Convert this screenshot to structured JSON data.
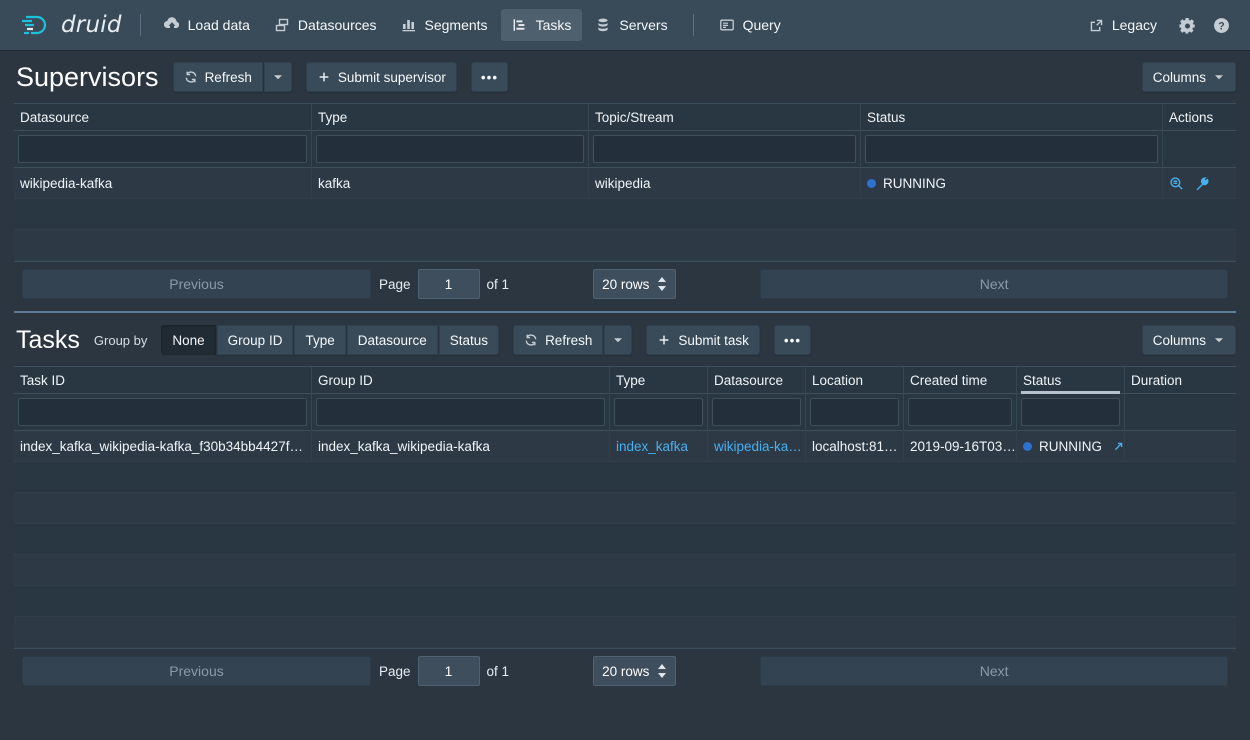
{
  "nav": {
    "brand": "druid",
    "items": [
      {
        "label": "Load data",
        "icon": "cloud-upload-icon",
        "active": false
      },
      {
        "label": "Datasources",
        "icon": "multi-layer-icon",
        "active": false
      },
      {
        "label": "Segments",
        "icon": "stacked-chart-icon",
        "active": false
      },
      {
        "label": "Tasks",
        "icon": "gantt-chart-icon",
        "active": true
      },
      {
        "label": "Servers",
        "icon": "database-icon",
        "active": false
      },
      {
        "label": "Query",
        "icon": "console-icon",
        "active": false
      }
    ],
    "right": {
      "legacy_label": "Legacy",
      "legacy_icon": "share-external-icon",
      "settings_icon": "gear-icon",
      "help_icon": "help-circle-icon"
    }
  },
  "supervisors": {
    "title": "Supervisors",
    "refresh_label": "Refresh",
    "refresh_icon": "refresh-icon",
    "caret_icon": "chevron-down-icon",
    "submit_label": "Submit supervisor",
    "submit_icon": "plus-icon",
    "more_label": "•••",
    "columns_label": "Columns",
    "columns": [
      "Datasource",
      "Type",
      "Topic/Stream",
      "Status",
      "Actions"
    ],
    "filter_placeholder": "",
    "rows": [
      {
        "datasource": "wikipedia-kafka",
        "type": "kafka",
        "topic": "wikipedia",
        "status": "RUNNING",
        "status_color": "#2d72d2",
        "actions": [
          "magnify-icon",
          "wrench-icon"
        ]
      }
    ],
    "empty_row_count": 2,
    "pagination": {
      "previous": "Previous",
      "page_label": "Page",
      "page_value": "1",
      "of_label": "of 1",
      "rows_value": "20 rows",
      "next": "Next"
    }
  },
  "tasks": {
    "title": "Tasks",
    "group_by_label": "Group by",
    "group_by_options": [
      {
        "label": "None",
        "active": true
      },
      {
        "label": "Group ID",
        "active": false
      },
      {
        "label": "Type",
        "active": false
      },
      {
        "label": "Datasource",
        "active": false
      },
      {
        "label": "Status",
        "active": false
      }
    ],
    "refresh_label": "Refresh",
    "refresh_icon": "refresh-icon",
    "caret_icon": "chevron-down-icon",
    "submit_label": "Submit task",
    "submit_icon": "plus-icon",
    "more_label": "•••",
    "columns_label": "Columns",
    "columns": [
      "Task ID",
      "Group ID",
      "Type",
      "Datasource",
      "Location",
      "Created time",
      "Status",
      "Duration"
    ],
    "sorted_column": "Status",
    "filter_placeholder": "",
    "rows": [
      {
        "task_id": "index_kafka_wikipedia-kafka_f30b34bb4427f…",
        "group_id": "index_kafka_wikipedia-kafka",
        "type": "index_kafka",
        "datasource": "wikipedia-ka…",
        "location": "localhost:81…",
        "created_time": "2019-09-16T03…",
        "status": "RUNNING",
        "status_color": "#2d72d2",
        "status_link_icon": "arrow-top-right-icon",
        "duration": ""
      }
    ],
    "empty_row_count": 6,
    "pagination": {
      "previous": "Previous",
      "page_label": "Page",
      "page_value": "1",
      "of_label": "of 1",
      "rows_value": "20 rows",
      "next": "Next"
    }
  }
}
